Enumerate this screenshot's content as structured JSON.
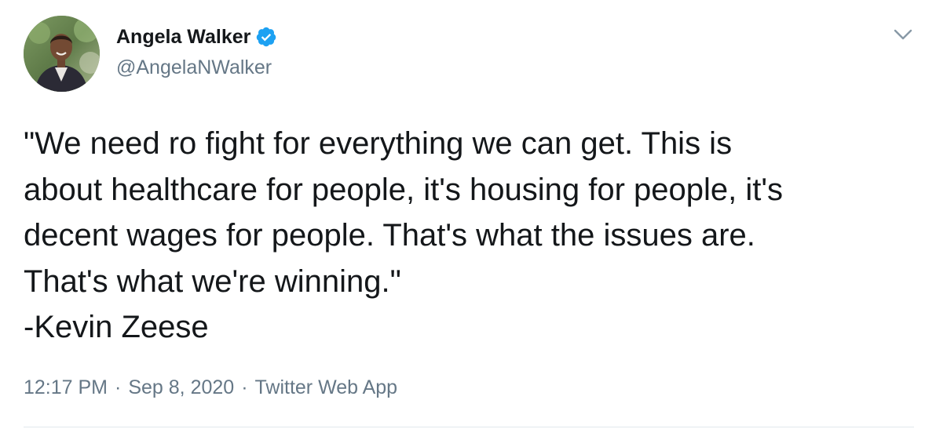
{
  "author": {
    "display_name": "Angela Walker",
    "handle": "@AngelaNWalker",
    "verified": true,
    "avatar_icon": "profile-photo-avatar"
  },
  "tweet": {
    "text": "\"We need ro fight for everything we can get. This is\nabout healthcare for people, it's housing for people, it's\ndecent wages for people. That's what the issues are.\nThat's what we're winning.\"\n-Kevin Zeese"
  },
  "meta": {
    "time": "12:17 PM",
    "separator_1": "·",
    "date": "Sep 8, 2020",
    "separator_2": "·",
    "source": "Twitter Web App"
  },
  "icons": {
    "verified": "verified-badge-icon",
    "menu": "chevron-down-icon"
  },
  "colors": {
    "text_primary": "#14171a",
    "text_secondary": "#657786",
    "verified_blue": "#1da1f2",
    "divider": "#e1e8ed"
  }
}
